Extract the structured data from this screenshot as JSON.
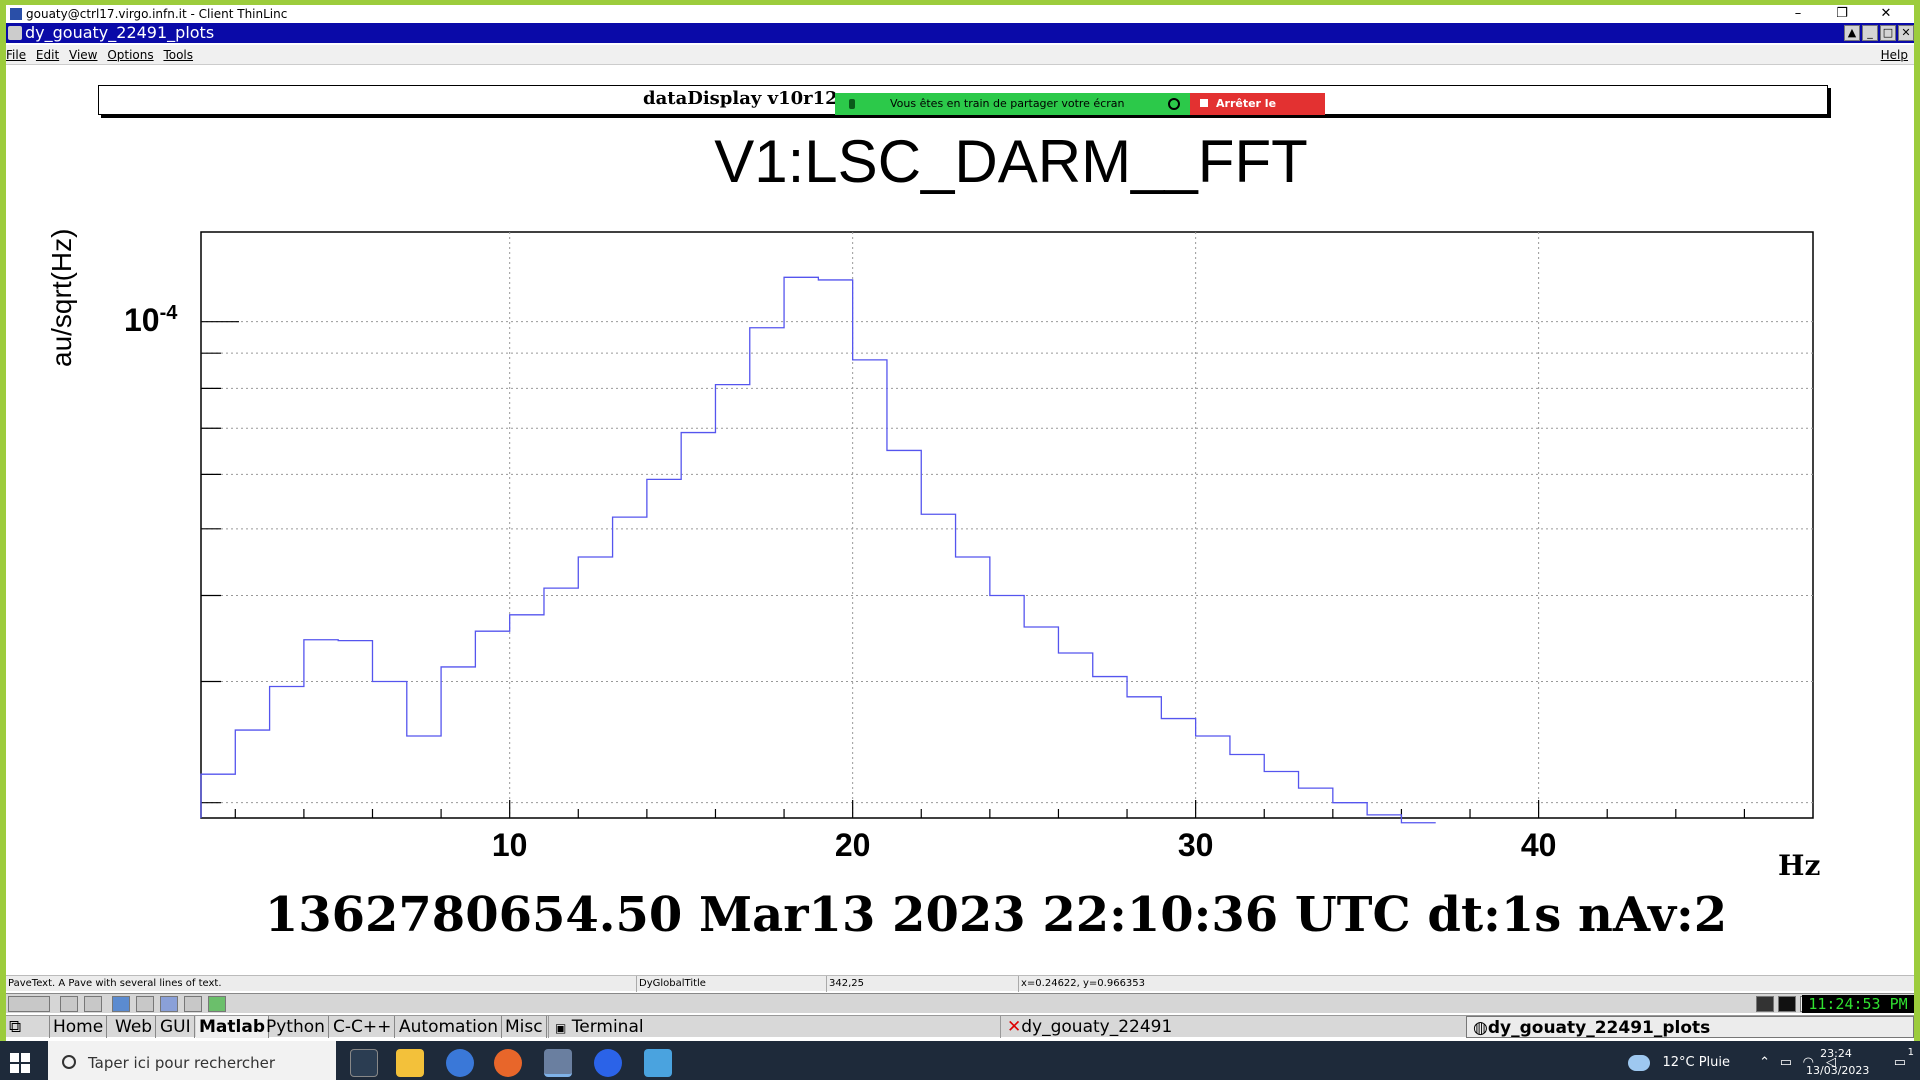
{
  "thinlinc": {
    "title": "gouaty@ctrl17.virgo.infn.it - Client ThinLinc",
    "minimize": "–",
    "restore": "❐",
    "close": "✕"
  },
  "window": {
    "title": "dy_gouaty_22491_plots"
  },
  "menu": {
    "items": [
      "File",
      "Edit",
      "View",
      "Options",
      "Tools"
    ],
    "help": "Help"
  },
  "display": {
    "box_title": "dataDisplay v10r12 :",
    "share_text": "Vous êtes en train de partager votre écran",
    "share_stop": "Arrêter le partage"
  },
  "chart_data": {
    "type": "line",
    "step": true,
    "title": "V1:LSC_DARM__FFT",
    "xlabel": "Hz",
    "ylabel": "au/sqrt(Hz)",
    "ylog": true,
    "ylim": [
      1.9e-05,
      0.000135
    ],
    "xlim": [
      1,
      48
    ],
    "x_ticks": [
      "10",
      "20",
      "30",
      "40"
    ],
    "y_tick_label": "10",
    "y_tick_exponent": "-4",
    "grid": true,
    "color": "#5555ee",
    "x": [
      1,
      2,
      3,
      4,
      5,
      6,
      7,
      8,
      9,
      10,
      11,
      12,
      13,
      14,
      15,
      16,
      17,
      18,
      19,
      20,
      21,
      22,
      23,
      24,
      25,
      26,
      27,
      28,
      29,
      30,
      31,
      32,
      33,
      34,
      35,
      36
    ],
    "values": [
      2.2e-05,
      2.55e-05,
      2.95e-05,
      3.45e-05,
      3.44e-05,
      3e-05,
      2.5e-05,
      3.15e-05,
      3.55e-05,
      3.75e-05,
      4.1e-05,
      4.55e-05,
      5.2e-05,
      5.9e-05,
      6.9e-05,
      8.1e-05,
      9.8e-05,
      0.000116,
      0.000115,
      8.8e-05,
      6.5e-05,
      5.25e-05,
      4.55e-05,
      4e-05,
      3.6e-05,
      3.3e-05,
      3.05e-05,
      2.85e-05,
      2.65e-05,
      2.5e-05,
      2.35e-05,
      2.22e-05,
      2.1e-05,
      2e-05,
      1.92e-05,
      1.87e-05
    ]
  },
  "footer": "1362780654.50 Mar13 2023 22:10:36 UTC dt:1s nAv:2",
  "status": {
    "object": "PaveText. A Pave with several lines of text.",
    "name": "DyGlobalTitle",
    "pixel": "342,25",
    "coords": "x=0.24622, y=0.966353"
  },
  "xdesktop": {
    "clock": "11:24:53 PM",
    "tabs": [
      "Home",
      "Web",
      "GUI",
      "Matlab",
      "Python",
      "C-C++",
      "Automation",
      "Misc"
    ],
    "selected_tab": "Matlab",
    "tasks": [
      "Terminal",
      "dy_gouaty_22491",
      "dy_gouaty_22491_plots"
    ]
  },
  "windows": {
    "search_placeholder": "Taper ici pour rechercher",
    "weather": "12°C  Pluie",
    "time": "23:24",
    "date": "13/03/2023",
    "notif": "1"
  }
}
